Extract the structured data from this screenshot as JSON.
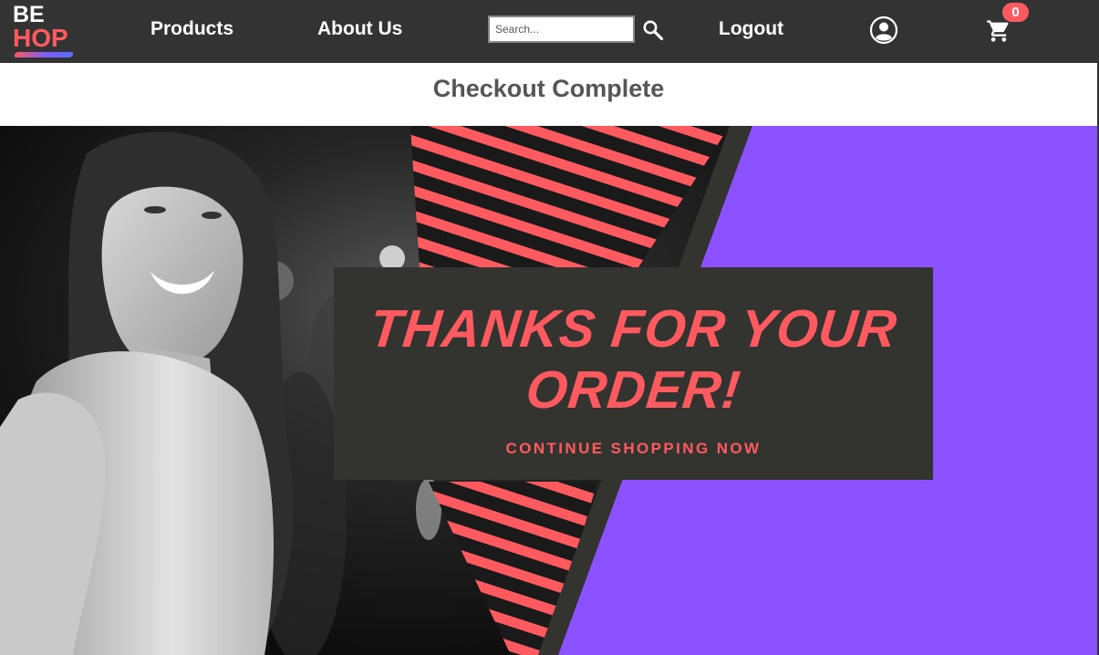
{
  "navbar": {
    "logo": {
      "line1": "BE",
      "line2": "HOP"
    },
    "links": {
      "products": "Products",
      "about": "About Us",
      "logout": "Logout"
    },
    "search": {
      "placeholder": "Search..."
    },
    "cart": {
      "count": "0"
    },
    "icons": [
      "search-icon",
      "user-account-icon",
      "shopping-cart-icon"
    ]
  },
  "page": {
    "title": "Checkout Complete"
  },
  "hero": {
    "headline_line1": "THANKS FOR YOUR",
    "headline_line2": "ORDER!",
    "cta": "CONTINUE SHOPPING NOW"
  },
  "colors": {
    "navbar_bg": "#333333",
    "accent_coral": "#ff5a5f",
    "accent_purple": "#8c52ff",
    "title_gray": "#555555",
    "box_dark": "#333330"
  }
}
